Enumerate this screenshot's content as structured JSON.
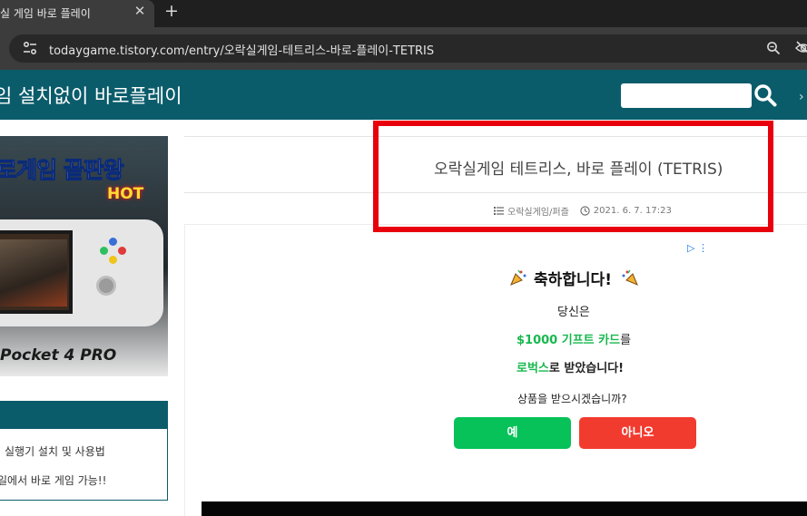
{
  "browser": {
    "tab_title": "실 게임 바로 플레이",
    "close_glyph": "✕",
    "new_tab_glyph": "+",
    "url": "todaygame.tistory.com/entry/오락실게임-테트리스-바로-플레이-TETRIS"
  },
  "header": {
    "site_title": "임 설치없이 바로플레이",
    "search_value": "",
    "edge_glyph": "›",
    "color": "#0b5c6b"
  },
  "sidebar": {
    "banner_headline": "로게임 끝판왕",
    "banner_hot": "HOT",
    "banner_footer": "Pocket 4 PRO",
    "category_items": [
      "실행기 설치 및 사용법",
      "일에서 바로 게임 가능!!"
    ]
  },
  "article": {
    "title": "오락실게임 테트리스, 바로 플레이 (TETRIS)",
    "category": "오락실게임/퍼즐",
    "date": "2021. 6. 7. 17:23"
  },
  "ad": {
    "adchoices": "▷ ⋮",
    "congrats": "축하합니다!",
    "line1": "당신은",
    "line2_highlight": "$1000 기프트 카드",
    "line2_rest": "를",
    "line3_highlight": "로벅스",
    "line3_rest": "로 받았습니다!",
    "question": "상품을 받으시겠습니까?",
    "yes_label": "예",
    "no_label": "아니오",
    "yes_color": "#06c258",
    "no_color": "#f23b2f"
  },
  "annotation": {
    "highlight_color": "#e8000d"
  }
}
